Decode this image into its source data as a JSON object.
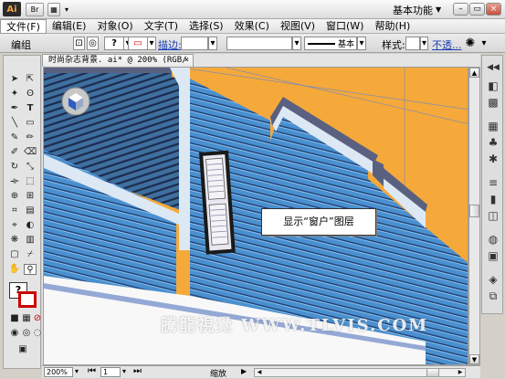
{
  "titlebar": {
    "logo": "Ai",
    "br_label": "Br",
    "layout_label": "▦",
    "workspace": "基本功能",
    "controls": {
      "minimize": "–",
      "restore": "▭",
      "close": "×"
    }
  },
  "menubar": {
    "items": [
      "文件(F)",
      "编辑(E)",
      "对象(O)",
      "文字(T)",
      "选择(S)",
      "效果(C)",
      "视图(V)",
      "窗口(W)",
      "帮助(H)"
    ]
  },
  "control_bar": {
    "selection_label": "编组",
    "stroke_label": "描边:",
    "stroke_style": "基本",
    "style_label": "样式:",
    "opacity_label": "不透..."
  },
  "document": {
    "tab_title": "时尚杂志背景. ai* @ 200% (RGB/预览)",
    "tab_close": "×",
    "zoom": "200%",
    "page_number": "1",
    "status_text": "缩放"
  },
  "canvas": {
    "callout_text": "显示“窗户”图层",
    "watermark_text": "騰龍視覺 WWW.TLVIS.COM"
  },
  "colors": {
    "sky_orange": "#F5A93A",
    "siding_blue": "#4A90D0",
    "trim_light": "#DDE8F5",
    "trim_dark": "#5A6180",
    "workspace_bg": "#D4D0C8"
  }
}
